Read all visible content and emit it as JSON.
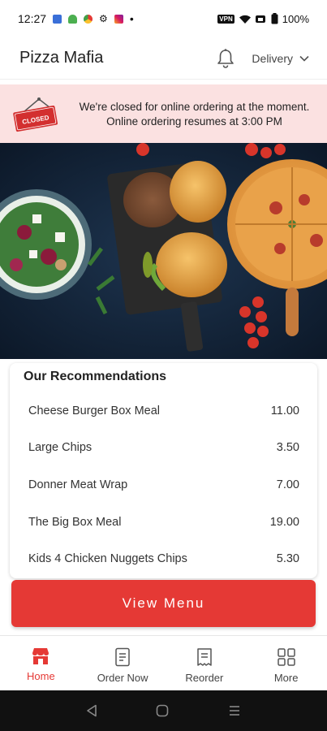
{
  "status_bar": {
    "time": "12:27",
    "dot": "•",
    "battery": "100%",
    "vpn": "VPN"
  },
  "header": {
    "app_title": "Pizza Mafia",
    "delivery_label": "Delivery"
  },
  "banner": {
    "sign_text": "CLOSED",
    "line1": "We're closed for online ordering at the moment.",
    "line2": "Online ordering resumes at 3:00 PM"
  },
  "recommendations": {
    "heading": "Our Recommendations",
    "items": [
      {
        "name": "Cheese Burger Box Meal",
        "price": "11.00"
      },
      {
        "name": "Large Chips",
        "price": "3.50"
      },
      {
        "name": "Donner Meat Wrap",
        "price": "7.00"
      },
      {
        "name": "The Big Box Meal",
        "price": "19.00"
      },
      {
        "name": "Kids 4 Chicken Nuggets Chips",
        "price": "5.30"
      }
    ]
  },
  "view_menu_label": "View Menu",
  "bottom_nav": [
    {
      "label": "Home",
      "icon": "store-icon",
      "active": true
    },
    {
      "label": "Order Now",
      "icon": "receipt-icon",
      "active": false
    },
    {
      "label": "Reorder",
      "icon": "reorder-icon",
      "active": false
    },
    {
      "label": "More",
      "icon": "grid-icon",
      "active": false
    }
  ],
  "colors": {
    "accent": "#e53935",
    "banner_bg": "#fbe1e1"
  }
}
